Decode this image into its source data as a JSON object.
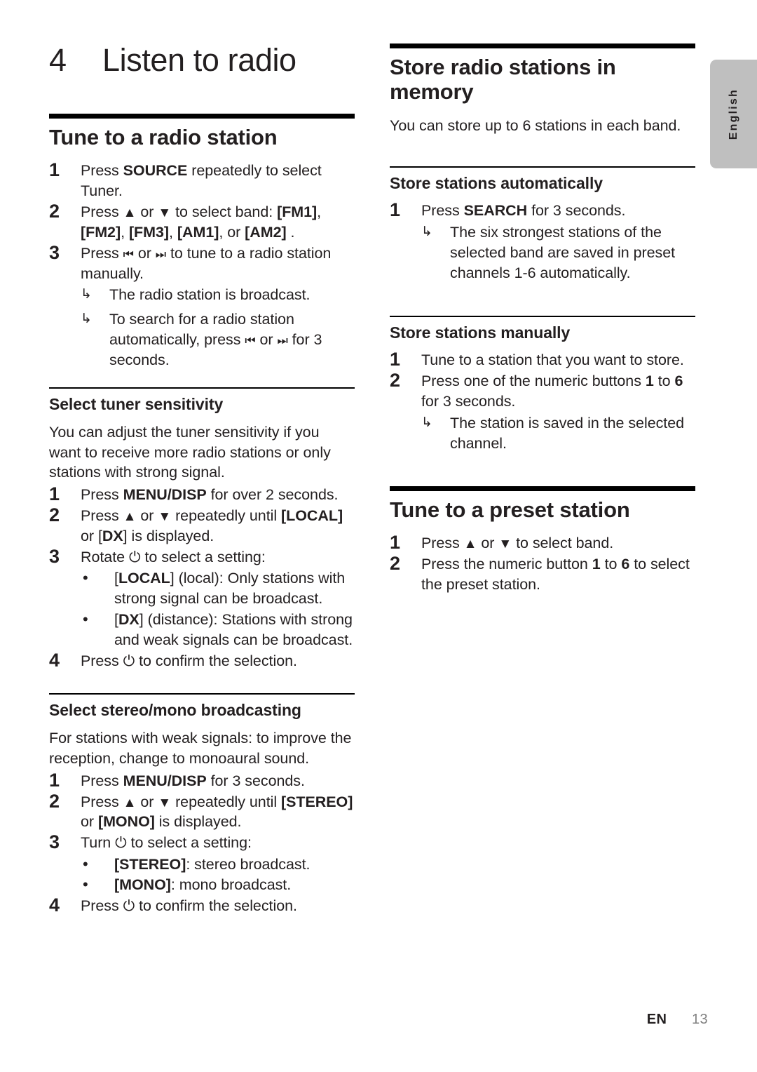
{
  "language_tab": {
    "label": "English"
  },
  "footer": {
    "locale_code": "EN",
    "page_number": "13"
  },
  "chapter": {
    "number": "4",
    "title": "Listen to radio"
  },
  "left_column": {
    "section_tune": {
      "heading": "Tune to a radio station",
      "steps": [
        {
          "num": "1",
          "text_parts": [
            "Press ",
            "SOURCE",
            " repeatedly to select Tuner."
          ]
        },
        {
          "num": "2",
          "text_parts": [
            "Press ",
            "▲",
            " or ",
            "▼",
            " to select band: ",
            "[FM1]",
            ", ",
            "[FM2]",
            ", ",
            "[FM3]",
            ", ",
            "[AM1]",
            ", or ",
            "[AM2]",
            " ."
          ]
        },
        {
          "num": "3",
          "text_parts": [
            "Press ",
            "⏮",
            " or ",
            "⏭",
            " to tune to a radio station manually."
          ]
        }
      ],
      "results": [
        "The radio station is broadcast.",
        "To search for a radio station automatically, press ⏮ or ⏭ for 3 seconds."
      ],
      "result_2_parts": [
        "To search for a radio station automatically, press ",
        "⏮",
        " or ",
        "⏭",
        " for 3 seconds."
      ]
    },
    "section_sensitivity": {
      "heading": "Select tuner sensitivity",
      "intro": "You can adjust the tuner sensitivity if you want to receive more radio stations or only stations with strong signal.",
      "steps": [
        {
          "num": "1",
          "pre": "Press ",
          "key": "MENU/DISP",
          "post": " for over 2 seconds."
        },
        {
          "num": "2",
          "pre": "Press ",
          "key": "",
          "post": ""
        },
        {
          "num": "3",
          "pre": "Rotate ",
          "key": "",
          "post": " to select a setting:"
        },
        {
          "num": "4",
          "pre": "Press ",
          "key": "",
          "post": " to confirm the selection."
        }
      ],
      "step2_text": "Press ▲ or ▼ repeatedly until [LOCAL] or [DX] is displayed.",
      "step3_text": "Rotate ⏻ to select a setting:",
      "step4_text": "Press ⏻ to confirm the selection.",
      "bullets": [
        {
          "label": "[LOCAL]",
          "text": " (local): Only stations with strong signal can be broadcast."
        },
        {
          "label": "[DX]",
          "text": " (distance): Stations with strong and weak signals can be broadcast."
        }
      ]
    },
    "section_stereo": {
      "heading": "Select stereo/mono broadcasting",
      "intro": "For stations with weak signals: to improve the reception, change to monoaural sound.",
      "step1_pre": "Press ",
      "step1_key": "MENU/DISP",
      "step1_post": " for 3 seconds.",
      "step2_text": "Press ▲ or ▼ repeatedly until [STEREO] or [MONO] is displayed.",
      "step3_text": "Turn ⏻ to select a setting:",
      "step4_text": "Press ⏻ to confirm the selection.",
      "bullets": [
        {
          "label": "[STEREO]",
          "text": ": stereo broadcast."
        },
        {
          "label": "[MONO]",
          "text": ": mono broadcast."
        }
      ]
    }
  },
  "right_column": {
    "section_store": {
      "heading": "Store radio stations in memory",
      "intro": "You can store up to 6 stations in each band."
    },
    "section_auto": {
      "heading": "Store stations automatically",
      "step1_pre": "Press ",
      "step1_key": "SEARCH",
      "step1_post": " for 3 seconds.",
      "result": "The six strongest stations of the selected band are saved in preset channels 1-6 automatically."
    },
    "section_manual": {
      "heading": "Store stations manually",
      "step1": "Tune to a station that you want to store.",
      "step2_pre": "Press one of the numeric buttons ",
      "step2_n1": "1",
      "step2_mid": " to ",
      "step2_n2": "6",
      "step2_post": " for 3 seconds.",
      "result": "The station is saved in the selected channel."
    },
    "section_preset": {
      "heading": "Tune to a preset station",
      "step1": "Press ▲ or ▼ to select band.",
      "step2_pre": "Press the numeric button ",
      "step2_n1": "1",
      "step2_mid": " to ",
      "step2_n2": "6",
      "step2_post": " to select the preset station."
    }
  },
  "symbols": {
    "up_arrow": "▲",
    "down_arrow": "▼",
    "prev_track": "⏮",
    "next_track": "⏭",
    "power": "⏻",
    "result_arrow": "↳",
    "bullet_dot": "•"
  }
}
